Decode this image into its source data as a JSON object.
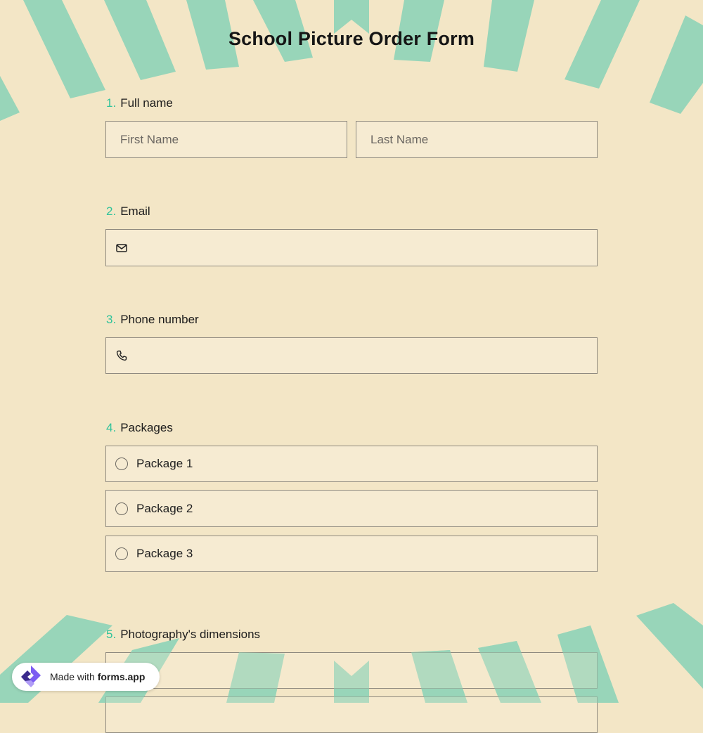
{
  "form": {
    "title": "School Picture Order Form",
    "accent_color": "#2fc39a",
    "background_color": "#f3e6c6",
    "stripe_color": "#98d5b9"
  },
  "questions": {
    "q1": {
      "number": "1.",
      "label": "Full name",
      "first_placeholder": "First Name",
      "last_placeholder": "Last Name"
    },
    "q2": {
      "number": "2.",
      "label": "Email",
      "icon": "mail-icon"
    },
    "q3": {
      "number": "3.",
      "label": "Phone number",
      "icon": "phone-icon"
    },
    "q4": {
      "number": "4.",
      "label": "Packages",
      "options": [
        "Package 1",
        "Package 2",
        "Package 3"
      ]
    },
    "q5": {
      "number": "5.",
      "label": "Photography's dimensions"
    }
  },
  "badge": {
    "prefix": "Made with",
    "brand": "forms.app"
  }
}
